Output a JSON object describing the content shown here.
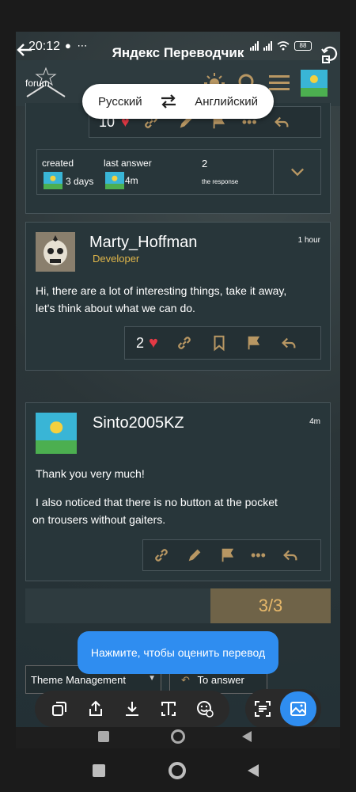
{
  "status_bar": {
    "time": "20:12",
    "battery": "88"
  },
  "app": {
    "title": "Яндекс Переводчик"
  },
  "forum": {
    "logo_text": "forum"
  },
  "lang": {
    "source": "Русский",
    "target": "Английский"
  },
  "topic_summary": {
    "top_likes": "10",
    "created_label": "created",
    "created_value": "3 days",
    "last_answer_label": "last answer",
    "last_answer_value": "4m",
    "responses_count": "2",
    "responses_label": "the response"
  },
  "posts": [
    {
      "username": "Marty_Hoffman",
      "role": "Developer",
      "time": "1 hour",
      "body": [
        "Hi, there are a lot of interesting things, take it away,",
        "let's think about what we can do."
      ],
      "likes": "2"
    },
    {
      "username": "Sinto2005KZ",
      "time": "4m",
      "body": [
        "Thank you very much!",
        "I also noticed that there is no button at the pocket",
        "on trousers without gaiters."
      ]
    }
  ],
  "pager": {
    "label": "3/3"
  },
  "toast": {
    "text": "Нажмите, чтобы оценить перевод"
  },
  "footer": {
    "theme_label": "Theme Management",
    "answer_label": "To answer"
  },
  "colors": {
    "accent": "#b89763",
    "heart": "#e53945",
    "toast": "#2f8df0",
    "role": "#e0b64a"
  }
}
